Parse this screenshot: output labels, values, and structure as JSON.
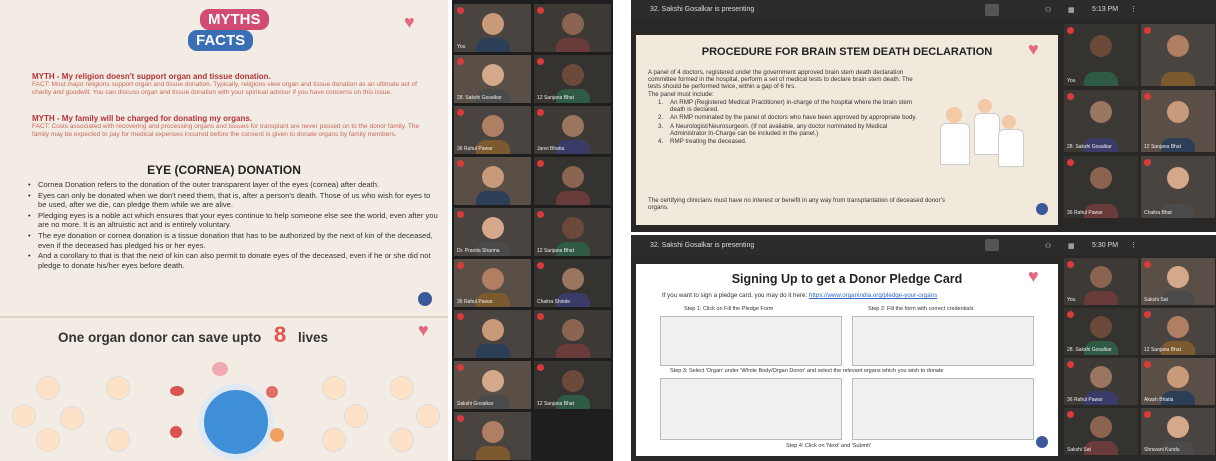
{
  "left_slide": {
    "badge_myths": "MYTHS",
    "badge_facts": "FACTS",
    "myth1_heading": "MYTH - My religion doesn't support organ and tissue donation.",
    "myth1_fact": "FACT: Most major religions support organ and tissue donation. Typically, religions view organ and tissue donation as an ultimate act of charity and goodwill. You can discuss organ and tissue donation with your spiritual advisor if you have concerns on this issue.",
    "myth2_heading": "MYTH - My family will be charged for donating my organs.",
    "myth2_fact": "FACT: Costs associated with recovering and processing organs and tissues for transplant are never passed on to the donor family. The family may be expected to pay for medical expenses incurred before the consent is given to donate organs by family members.",
    "eye_title": "EYE (CORNEA) DONATION",
    "eye_bullets": [
      "Cornea Donation refers to the donation of the outer transparent layer of the eyes (cornea) after death.",
      "Eyes can only be donated when we don't need them, that is, after a person's death. Those of us who wish for eyes to be used, after we die, can pledge them while we are alive.",
      "Pledging eyes is a noble act which ensures that your eyes continue to help someone else see the world, even after you are no more. It is an altruistic act and is entirely voluntary.",
      "The eye donation or cornea donation is a tissue donation that has to be authorized by the next of kin of the deceased, even if the deceased has pledged his or her eyes.",
      "And a corollary to that is that the next of kin can also permit to donate eyes of the deceased, even if he or she did not pledge to donate his/her eyes before death."
    ],
    "donor_title": "One organ donor can save upto",
    "donor_number": "8",
    "donor_lives": "lives"
  },
  "left_video_tiles": [
    {
      "name": "You"
    },
    {
      "name": ""
    },
    {
      "name": "28. Sakshi Gosalkar"
    },
    {
      "name": "12 Sanjana Bhat"
    },
    {
      "name": "36 Rahul Pawar"
    },
    {
      "name": "Janvi Bhatia"
    },
    {
      "name": ""
    },
    {
      "name": ""
    },
    {
      "name": "Dr. Pranita Sharma"
    },
    {
      "name": "12 Sanjana Bhat"
    },
    {
      "name": "36 Rahul Pawar"
    },
    {
      "name": "Chaitra Shinde"
    },
    {
      "name": ""
    },
    {
      "name": ""
    },
    {
      "name": "Sakshi Gosalkar"
    },
    {
      "name": "12 Sanjana Bhat"
    },
    {
      "name": ""
    }
  ],
  "meeting_top": {
    "presenting": "32. Sakshi Gosalkar is presenting",
    "time": "5:13 PM",
    "slide_title": "PROCEDURE FOR BRAIN STEM DEATH DECLARATION",
    "intro": "A panel of 4 doctors, registered under the government approved brain stem death declaration committee formed in the hospital, perform a set of medical tests to declare brain stem death. The tests should be performed twice, within a gap of 6 hrs.",
    "panel_label": "The panel must include:",
    "items": [
      "An RMP (Registered Medical Practitioner) in-charge of the hospital where the brain stem death is declared.",
      "An RMP nominated by the panel of doctors who have been approved by appropriate body.",
      "A Neurologist/Neurosurgeon. (If not available, any doctor nominated by Medical Administrator In-Charge can be included in the panel.)",
      "RMP treating the deceased."
    ],
    "footer": "The certifying clinicians must have no interest or benefit in any way from transplantation of deceased donor's organs.",
    "tiles": [
      {
        "name": "You"
      },
      {
        "name": ""
      },
      {
        "name": "28. Sakshi Gosalkar"
      },
      {
        "name": "12 Sanjana Bhat"
      },
      {
        "name": "36 Rahul Pawar"
      },
      {
        "name": "Chaitra Bhat"
      }
    ]
  },
  "meeting_bottom": {
    "presenting": "32. Sakshi Gosalkar is presenting",
    "time": "5:30 PM",
    "slide_title": "Signing Up to get a Donor Pledge Card",
    "intro": "If you want to sign a pledge card, you may do it here:",
    "link": "https://www.organindia.org/pledge-your-organs",
    "step1": "Step 1: Click on Fill the Pledge Form",
    "step2": "Step 2: Fill the form with correct credentials",
    "step3": "Step 3: Select 'Organ' under 'Whole Body/Organ Donor' and select the relevant organs which you wish to donate",
    "step4": "Step 4: Click on 'Next' and 'Submit'",
    "tiles": [
      {
        "name": "You"
      },
      {
        "name": "Sakshi Sat"
      },
      {
        "name": "28. Sakshi Gosalkar"
      },
      {
        "name": "12 Sanjana Bhat"
      },
      {
        "name": "36 Rahul Pawar"
      },
      {
        "name": "Akash Bhatia"
      },
      {
        "name": "Sakshi Sat"
      },
      {
        "name": "Shravani Kundu"
      }
    ]
  }
}
